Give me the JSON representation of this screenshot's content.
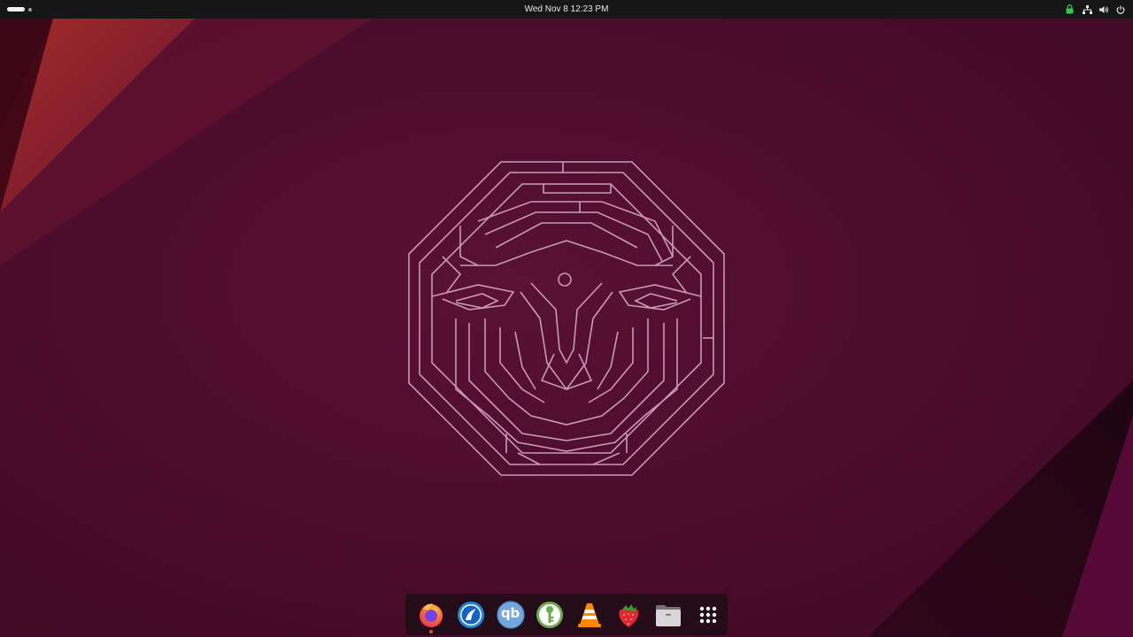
{
  "topbar": {
    "clock": "Wed Nov 8  12:23 PM",
    "activities_icon": "workspace-indicator",
    "tray_icons": [
      "lock-icon",
      "network-wired-icon",
      "volume-icon",
      "power-icon"
    ]
  },
  "desktop": {
    "wallpaper": "Ubuntu Mantic Minotaur maze wallpaper",
    "colors": {
      "background": "#4a0d2c",
      "accent_red": "#b2302c",
      "maze_stroke": "#c79ab7",
      "ubuntu_orange": "#e95420"
    }
  },
  "dock": {
    "apps": [
      {
        "name": "Firefox",
        "icon": "firefox-icon",
        "running": true
      },
      {
        "name": "Remmina",
        "icon": "remmina-icon",
        "running": false
      },
      {
        "name": "qBittorrent",
        "icon": "qbittorrent-icon",
        "running": false
      },
      {
        "name": "KeePassXC",
        "icon": "keepassxc-icon",
        "running": false
      },
      {
        "name": "VLC media player",
        "icon": "vlc-icon",
        "running": false
      },
      {
        "name": "Strawberry",
        "icon": "strawberry-icon",
        "running": false
      },
      {
        "name": "Files",
        "icon": "files-icon",
        "running": false
      },
      {
        "name": "Show Apps",
        "icon": "app-grid-icon",
        "running": false
      }
    ],
    "qbittorrent_label": "qb"
  }
}
